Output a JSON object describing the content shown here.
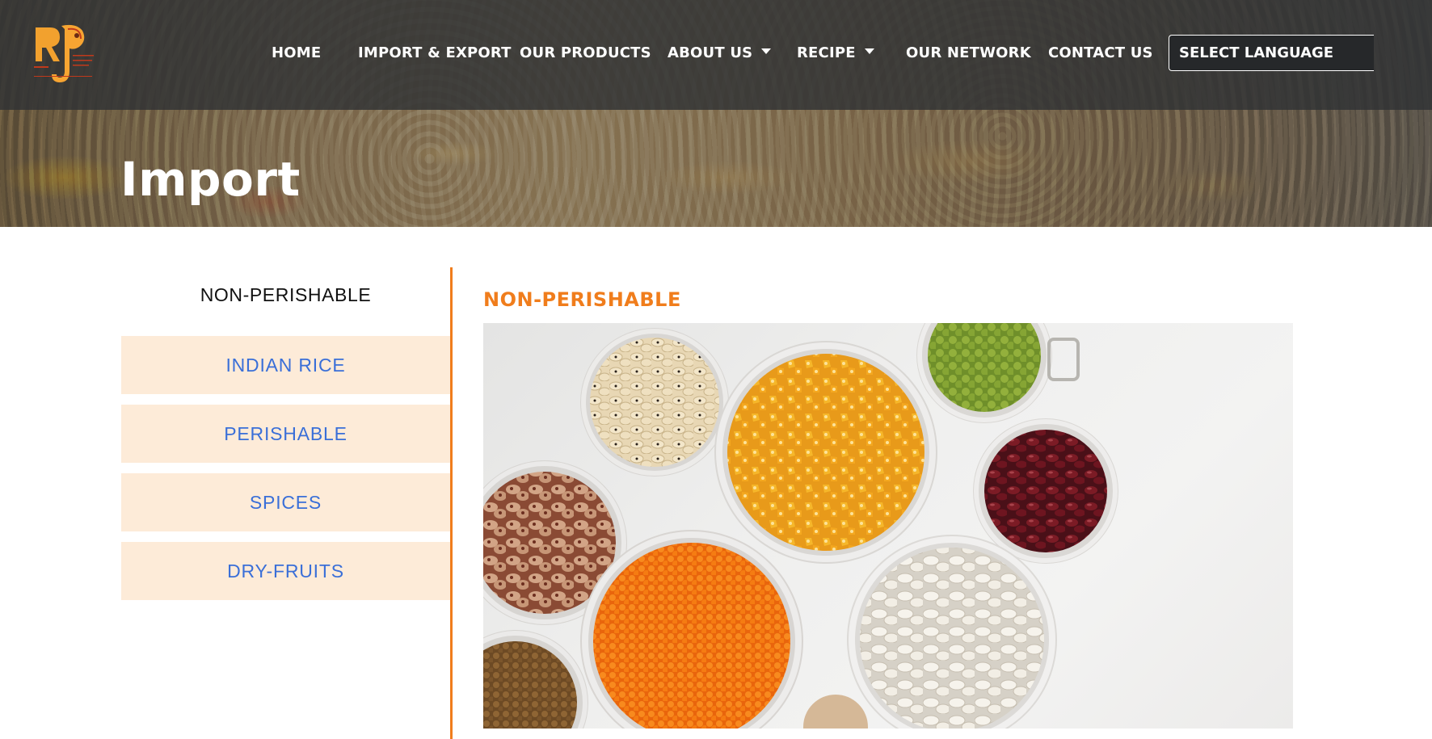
{
  "brand": {
    "logo_letters": "RJP",
    "logo_since": "Since 1956"
  },
  "nav": {
    "items": [
      {
        "label": "HOME",
        "dropdown": false
      },
      {
        "label": "IMPORT & EXPORT",
        "dropdown": false
      },
      {
        "label": "OUR PRODUCTS",
        "dropdown": false
      },
      {
        "label": "ABOUT US",
        "dropdown": true
      },
      {
        "label": "RECIPE",
        "dropdown": true
      },
      {
        "label": "OUR NETWORK",
        "dropdown": false
      },
      {
        "label": "CONTACT US",
        "dropdown": false
      }
    ],
    "language_select": "SELECT LANGUAGE"
  },
  "hero": {
    "title": "Import"
  },
  "sidebar": {
    "active_heading": "NON-PERISHABLE",
    "items": [
      {
        "label": "INDIAN RICE"
      },
      {
        "label": "PERISHABLE"
      },
      {
        "label": "SPICES"
      },
      {
        "label": "DRY-FRUITS"
      }
    ]
  },
  "main": {
    "section_title": "NON-PERISHABLE"
  },
  "colors": {
    "accent_orange": "#f07d1c",
    "link_blue": "#3a6fd8",
    "tab_background": "#fdebd8",
    "topbar": "#303234"
  }
}
